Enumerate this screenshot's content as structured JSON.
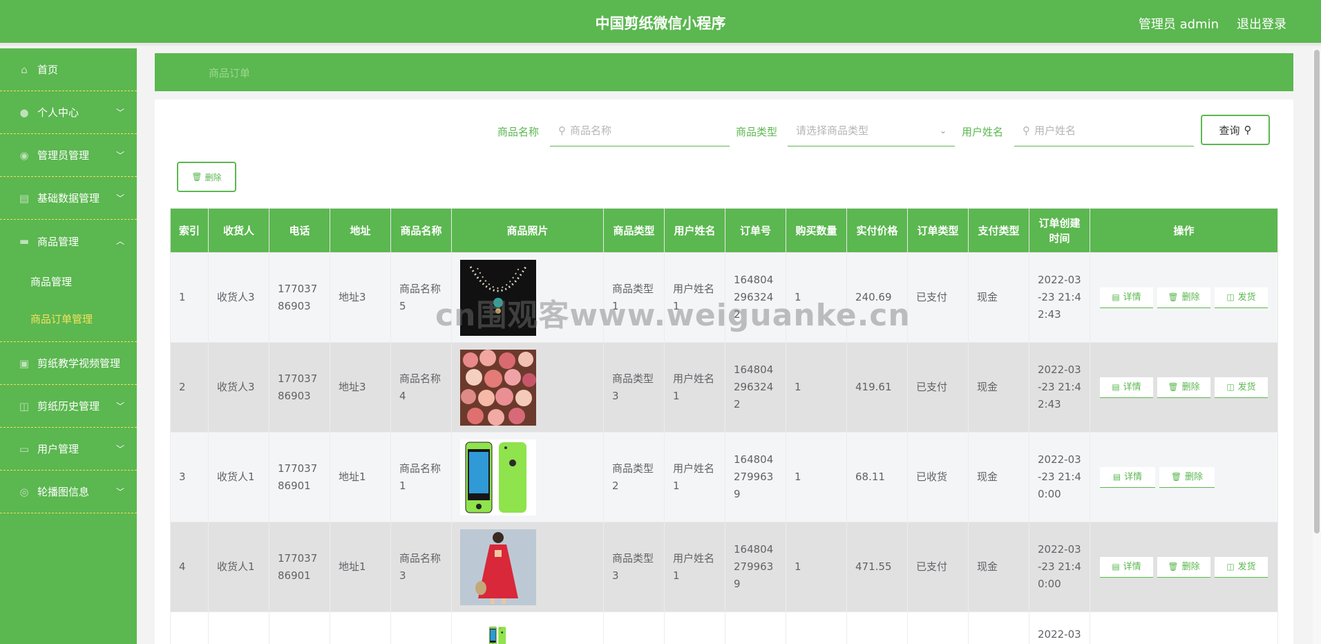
{
  "header": {
    "title": "中国剪纸微信小程序",
    "admin": "管理员 admin",
    "logout": "退出登录"
  },
  "sidebar": {
    "items": [
      {
        "label": "首页",
        "icon": "home-icon",
        "has_arrow": false
      },
      {
        "label": "个人中心",
        "icon": "user-icon",
        "has_arrow": true
      },
      {
        "label": "管理员管理",
        "icon": "admin-icon",
        "has_arrow": true
      },
      {
        "label": "基础数据管理",
        "icon": "data-icon",
        "has_arrow": true
      },
      {
        "label": "商品管理",
        "icon": "goods-icon",
        "has_arrow": true,
        "expanded": true,
        "children": [
          {
            "label": "商品管理"
          },
          {
            "label": "商品订单管理",
            "active": true
          }
        ]
      },
      {
        "label": "剪纸教学视频管理",
        "icon": "video-icon",
        "has_arrow": false
      },
      {
        "label": "剪纸历史管理",
        "icon": "history-icon",
        "has_arrow": true
      },
      {
        "label": "用户管理",
        "icon": "users-icon",
        "has_arrow": true
      },
      {
        "label": "轮播图信息",
        "icon": "carousel-icon",
        "has_arrow": true
      }
    ]
  },
  "breadcrumb": "商品订单",
  "search": {
    "name_label": "商品名称",
    "name_placeholder": "商品名称",
    "type_label": "商品类型",
    "type_placeholder": "请选择商品类型",
    "user_label": "用户姓名",
    "user_placeholder": "用户姓名",
    "query_label": "查询"
  },
  "delete_label": "删除",
  "table": {
    "headers": [
      "索引",
      "收货人",
      "电话",
      "地址",
      "商品名称",
      "商品照片",
      "商品类型",
      "用户姓名",
      "订单号",
      "购买数量",
      "实付价格",
      "订单类型",
      "支付类型",
      "订单创建时间",
      "操作"
    ],
    "rows": [
      {
        "index": "1",
        "receiver": "收货人3",
        "phone": "17703786903",
        "address": "地址3",
        "goods_name": "商品名称5",
        "photo": "necklace",
        "goods_type": "商品类型1",
        "user": "用户姓名1",
        "order_no": "1648042963242",
        "qty": "1",
        "price": "240.69",
        "order_type": "已支付",
        "pay_type": "现金",
        "created": "2022-03-23 21:42:43",
        "actions": [
          "详情",
          "删除",
          "发货"
        ]
      },
      {
        "index": "2",
        "receiver": "收货人3",
        "phone": "17703786903",
        "address": "地址3",
        "goods_name": "商品名称4",
        "photo": "flowers",
        "goods_type": "商品类型3",
        "user": "用户姓名1",
        "order_no": "1648042963242",
        "qty": "1",
        "price": "419.61",
        "order_type": "已支付",
        "pay_type": "现金",
        "created": "2022-03-23 21:42:43",
        "actions": [
          "详情",
          "删除",
          "发货"
        ]
      },
      {
        "index": "3",
        "receiver": "收货人1",
        "phone": "17703786901",
        "address": "地址1",
        "goods_name": "商品名称1",
        "photo": "phone",
        "goods_type": "商品类型2",
        "user": "用户姓名1",
        "order_no": "1648042799639",
        "qty": "1",
        "price": "68.11",
        "order_type": "已收货",
        "pay_type": "现金",
        "created": "2022-03-23 21:40:00",
        "actions": [
          "详情",
          "删除"
        ]
      },
      {
        "index": "4",
        "receiver": "收货人1",
        "phone": "17703786901",
        "address": "地址1",
        "goods_name": "商品名称3",
        "photo": "dress",
        "goods_type": "商品类型3",
        "user": "用户姓名1",
        "order_no": "1648042799639",
        "qty": "1",
        "price": "471.55",
        "order_type": "已支付",
        "pay_type": "现金",
        "created": "2022-03-23 21:40:00",
        "actions": [
          "详情",
          "删除",
          "发货"
        ]
      },
      {
        "index": "",
        "receiver": "",
        "phone": "",
        "address": "",
        "goods_name": "",
        "photo": "phone",
        "goods_type": "",
        "user": "",
        "order_no": "",
        "qty": "",
        "price": "",
        "order_type": "",
        "pay_type": "",
        "created": "2022-03",
        "actions": []
      }
    ]
  },
  "watermark": "cn围观客www.weiguanke.cn",
  "colors": {
    "primary": "#5bb750",
    "active_menu": "#f7e15c",
    "divider": "#f6e05e"
  }
}
